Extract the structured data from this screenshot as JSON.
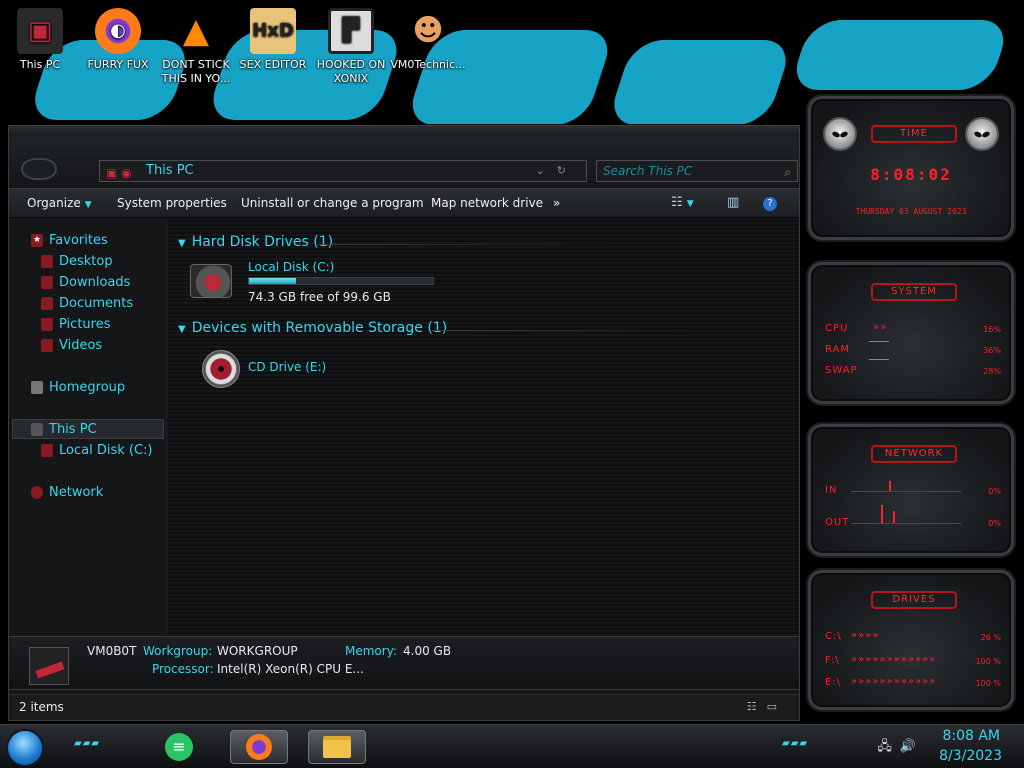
{
  "desktop": {
    "icons": [
      {
        "label": "This PC",
        "icon": "computer-icon"
      },
      {
        "label": "FURRY FUX",
        "icon": "firefox-icon"
      },
      {
        "label": "DONT STICK THIS IN YO...",
        "icon": "vlc-icon"
      },
      {
        "label": "SEX EDITOR",
        "icon": "hxd-icon"
      },
      {
        "label": "HOOKED ON XONIX",
        "icon": "xonix-icon"
      },
      {
        "label": "VM0Technic...",
        "icon": "user-icon"
      }
    ]
  },
  "explorer": {
    "address": "This PC",
    "search_placeholder": "Search This PC",
    "toolbar": {
      "organize": "Organize",
      "system_properties": "System properties",
      "uninstall": "Uninstall or change a program",
      "map_drive": "Map network drive",
      "more": "»"
    },
    "sidebar": {
      "favorites": "Favorites",
      "desktop": "Desktop",
      "downloads": "Downloads",
      "documents": "Documents",
      "pictures": "Pictures",
      "videos": "Videos",
      "homegroup": "Homegroup",
      "this_pc": "This PC",
      "local_disk": "Local Disk (C:)",
      "network": "Network"
    },
    "groups": {
      "hard_disks": "Hard Disk Drives (1)",
      "removable": "Devices with Removable Storage (1)"
    },
    "drives": {
      "c_name": "Local Disk (C:)",
      "c_free": "74.3 GB free of 99.6 GB",
      "c_used_fraction": 0.254,
      "e_name": "CD Drive (E:)"
    },
    "details": {
      "computer_name": "VM0B0T",
      "workgroup_label": "Workgroup:",
      "workgroup_value": "WORKGROUP",
      "memory_label": "Memory:",
      "memory_value": "4.00 GB",
      "processor_label": "Processor:",
      "processor_value": "Intel(R) Xeon(R) CPU E..."
    },
    "status": "2 items"
  },
  "gadgets": {
    "time": {
      "title": "TIME",
      "clock": "8:08:02",
      "date": "THURSDAY 03 AUGUST 2023"
    },
    "system": {
      "title": "SYSTEM",
      "cpu_label": "CPU",
      "cpu_value": "16%",
      "ram_label": "RAM",
      "ram_value": "36%",
      "swap_label": "SWAP",
      "swap_value": "28%"
    },
    "network": {
      "title": "NETWORK",
      "in_label": "IN",
      "in_value": "0%",
      "out_label": "OUT",
      "out_value": "0%"
    },
    "drives": {
      "title": "DRIVES",
      "c_label": "C:\\",
      "c_value": "26 %",
      "f_label": "F:\\",
      "f_value": "100 %",
      "e_label": "E:\\",
      "e_value": "100 %"
    }
  },
  "taskbar": {
    "time": "8:08 AM",
    "date": "8/3/2023"
  },
  "colors": {
    "accent": "#3ad6ee",
    "gadget_red": "#ff1f2b",
    "wallpaper_blue": "#17a3c6"
  }
}
